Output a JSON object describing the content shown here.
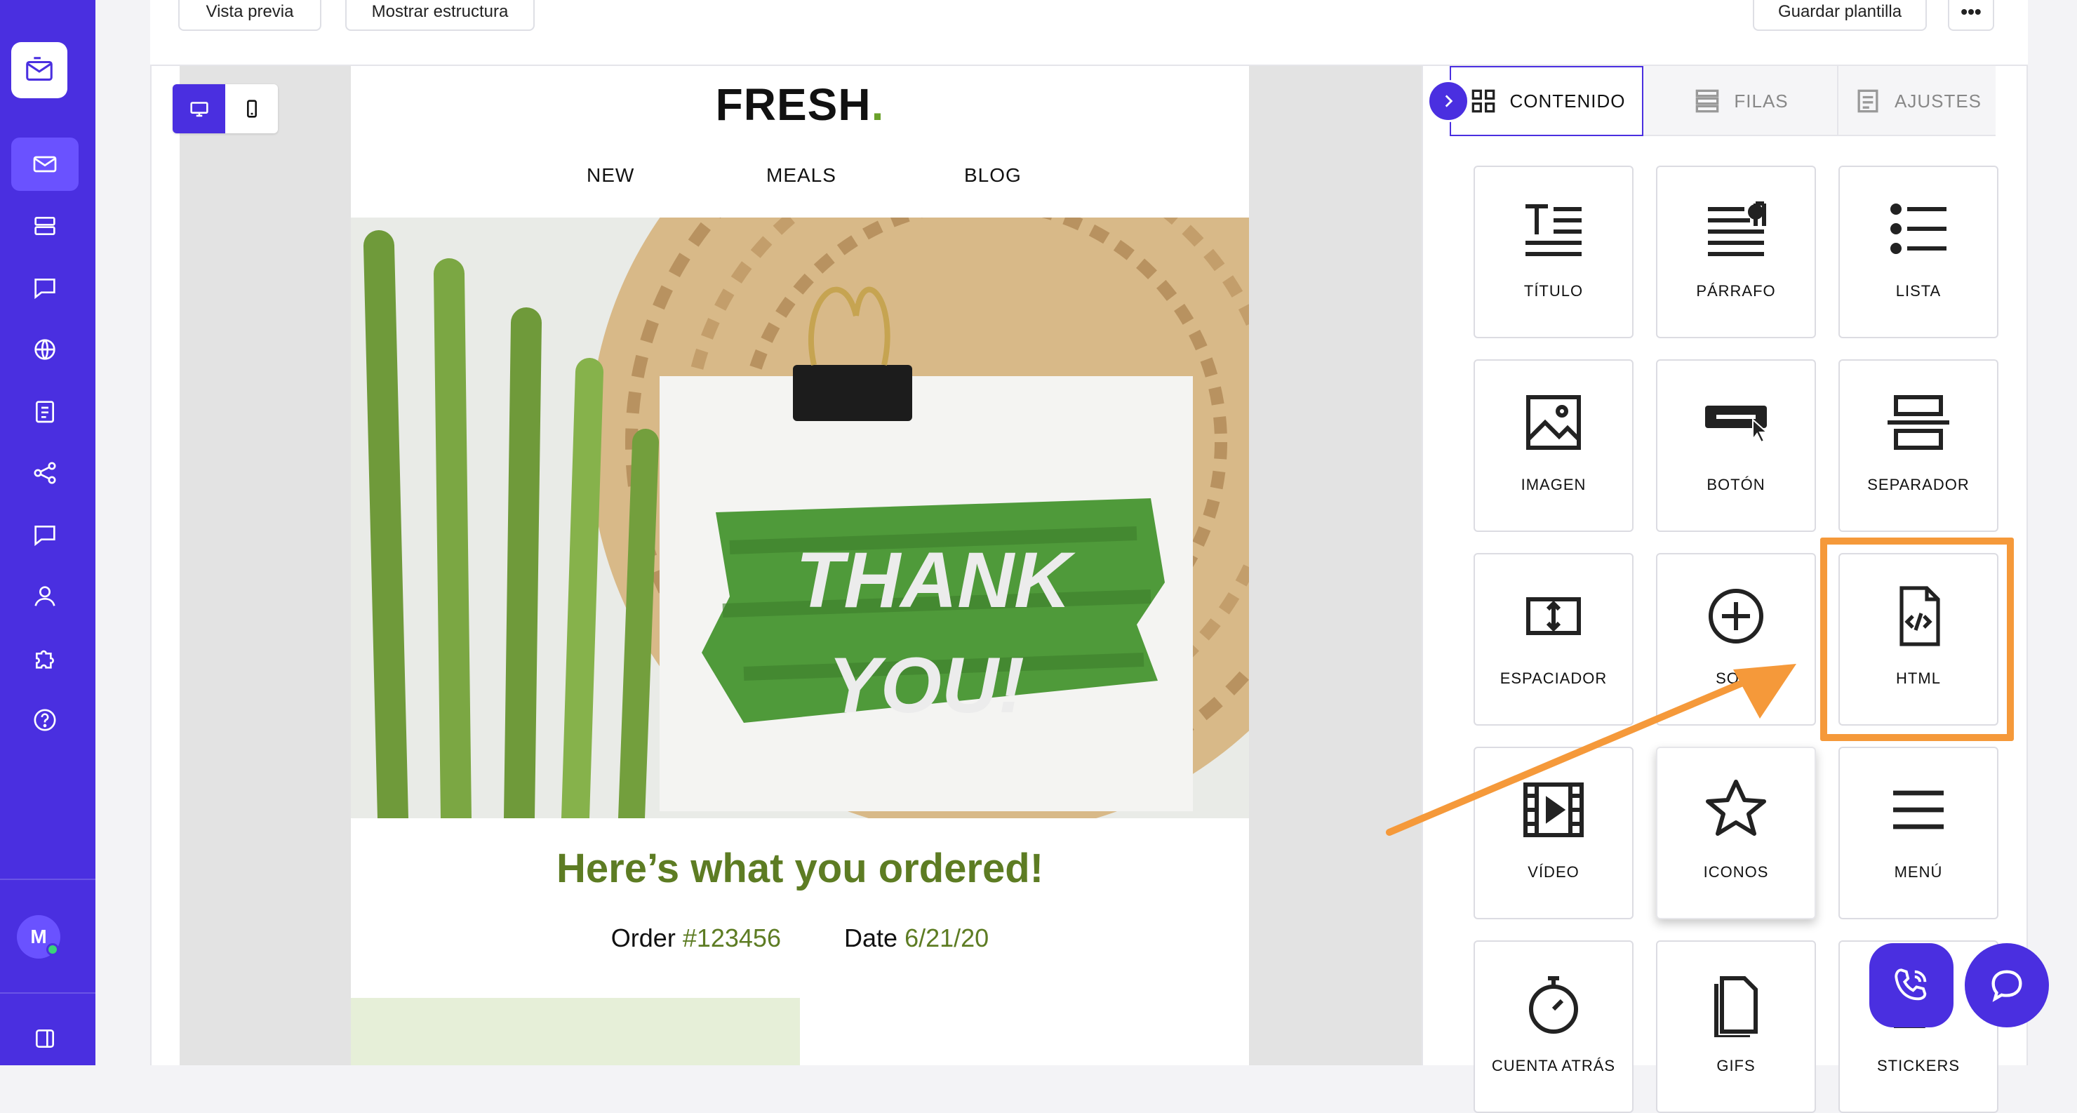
{
  "toolbar": {
    "preview_label": "Vista previa",
    "structure_label": "Mostrar estructura",
    "save_template_label": "Guardar plantilla",
    "more_label": "•••"
  },
  "sidebar": {
    "avatar_initial": "M",
    "items": [
      {
        "icon": "mail-icon",
        "active": true
      },
      {
        "icon": "layers-icon"
      },
      {
        "icon": "chat-icon"
      },
      {
        "icon": "globe-icon"
      },
      {
        "icon": "clipboard-icon"
      },
      {
        "icon": "share-icon"
      },
      {
        "icon": "message-icon"
      },
      {
        "icon": "user-icon"
      },
      {
        "icon": "puzzle-icon"
      },
      {
        "icon": "help-icon"
      }
    ]
  },
  "email": {
    "brand": "FRESH",
    "brand_dot": ".",
    "nav": [
      "NEW",
      "MEALS",
      "BLOG"
    ],
    "hero_text_1": "THANK",
    "hero_text_2": "YOU!",
    "headline": "Here’s what you ordered!",
    "order_label": "Order",
    "order_value": "#123456",
    "date_label": "Date",
    "date_value": "6/21/20"
  },
  "builder": {
    "tabs": [
      {
        "label": "CONTENIDO",
        "icon": "grid-icon",
        "active": true
      },
      {
        "label": "FILAS",
        "icon": "rows-icon"
      },
      {
        "label": "AJUSTES",
        "icon": "settings-list-icon"
      }
    ],
    "tiles": [
      {
        "label": "TÍTULO",
        "icon": "title-icon"
      },
      {
        "label": "PÁRRAFO",
        "icon": "paragraph-icon"
      },
      {
        "label": "LISTA",
        "icon": "list-icon"
      },
      {
        "label": "IMAGEN",
        "icon": "image-icon"
      },
      {
        "label": "BOTÓN",
        "icon": "button-icon"
      },
      {
        "label": "SEPARADOR",
        "icon": "divider-icon"
      },
      {
        "label": "ESPACIADOR",
        "icon": "spacer-icon"
      },
      {
        "label": "SOCI",
        "icon": "social-icon"
      },
      {
        "label": "HTML",
        "icon": "html-icon"
      },
      {
        "label": "VÍDEO",
        "icon": "video-icon"
      },
      {
        "label": "ICONOS",
        "icon": "star-icon"
      },
      {
        "label": "MENÚ",
        "icon": "menu-icon"
      },
      {
        "label": "CUENTA ATRÁS",
        "icon": "timer-icon"
      },
      {
        "label": "GIFS",
        "icon": "gif-icon"
      },
      {
        "label": "STICKERS",
        "icon": "sticker-icon"
      }
    ]
  },
  "colors": {
    "brand_purple": "#4a2fe0",
    "accent_green": "#5d7c23",
    "highlight_orange": "#f5993a"
  }
}
